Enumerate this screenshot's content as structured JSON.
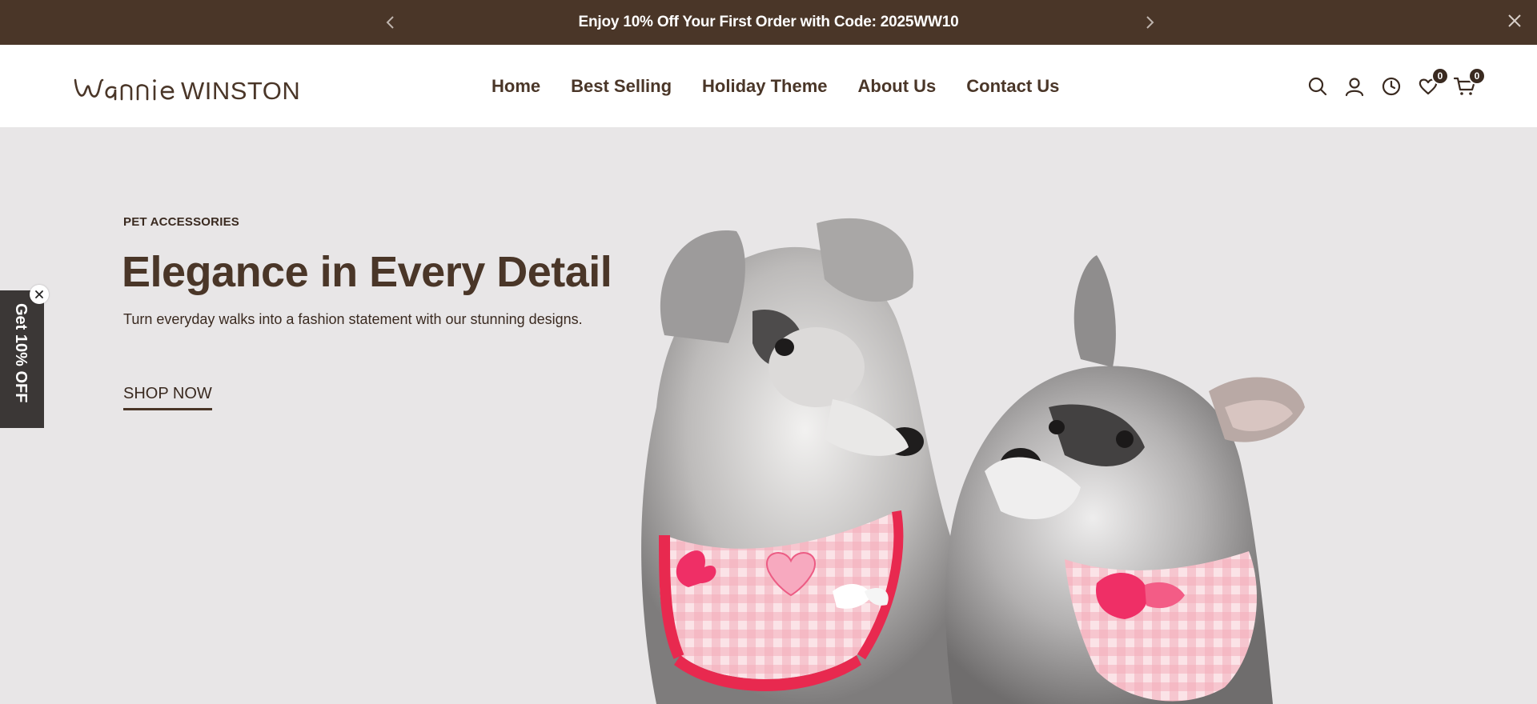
{
  "announcement": {
    "text": "Enjoy 10% Off Your First Order with Code: 2025WW10"
  },
  "brand": {
    "logo_text": "WannieWinston",
    "color_primary": "#4a3628",
    "color_dark": "#3a2a20",
    "hero_bg": "#e8e6e7"
  },
  "nav": {
    "items": [
      {
        "label": "Home"
      },
      {
        "label": "Best Selling"
      },
      {
        "label": "Holiday Theme"
      },
      {
        "label": "About Us"
      },
      {
        "label": "Contact Us"
      }
    ]
  },
  "header_icons": {
    "search": "search-icon",
    "account": "user-icon",
    "recent": "clock-icon",
    "wishlist": "heart-icon",
    "wishlist_count": "0",
    "cart": "cart-icon",
    "cart_count": "0"
  },
  "hero": {
    "eyebrow": "PET ACCESSORIES",
    "headline": "Elegance in Every Detail",
    "subhead": "Turn everyday walks into a fashion statement with our stunning designs.",
    "cta": "SHOP NOW"
  },
  "side_tab": {
    "label": "Get 10% OFF"
  }
}
